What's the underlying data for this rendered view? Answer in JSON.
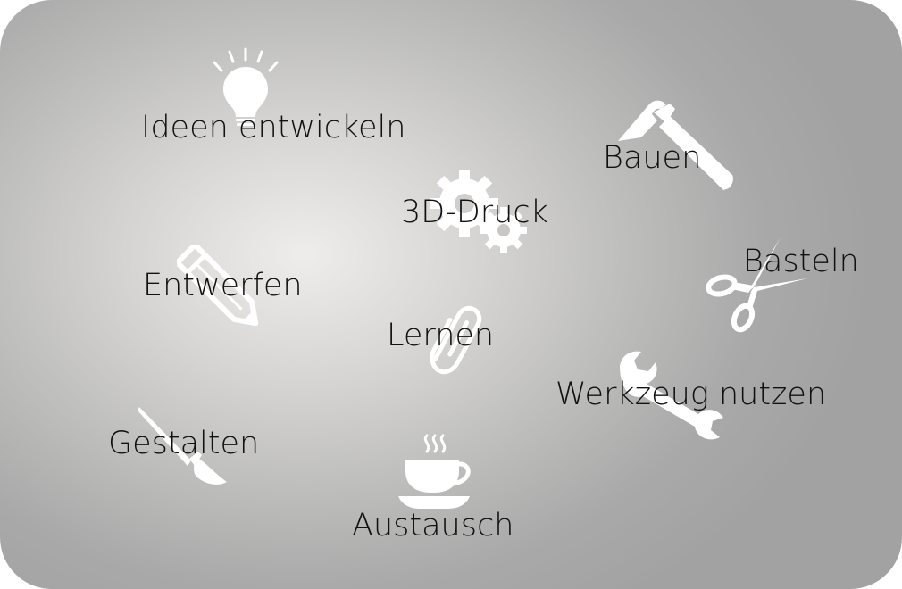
{
  "activities": [
    {
      "id": "ideen",
      "label": "Ideen entwickeln",
      "icon": "lightbulb-icon"
    },
    {
      "id": "bauen",
      "label": "Bauen",
      "icon": "hammer-icon"
    },
    {
      "id": "druck",
      "label": "3D-Druck",
      "icon": "gears-icon"
    },
    {
      "id": "basteln",
      "label": "Basteln",
      "icon": "scissors-icon"
    },
    {
      "id": "entwerfen",
      "label": "Entwerfen",
      "icon": "pencil-icon"
    },
    {
      "id": "lernen",
      "label": "Lernen",
      "icon": "paperclip-icon"
    },
    {
      "id": "werkzeug",
      "label": "Werkzeug nutzen",
      "icon": "wrench-icon"
    },
    {
      "id": "gestalten",
      "label": "Gestalten",
      "icon": "paintbrush-icon"
    },
    {
      "id": "austausch",
      "label": "Austausch",
      "icon": "coffee-cup-icon"
    }
  ],
  "colors": {
    "icon": "#ffffff",
    "text": "#111111",
    "background_center": "#efedea",
    "background_edge": "#a2a2a2"
  }
}
